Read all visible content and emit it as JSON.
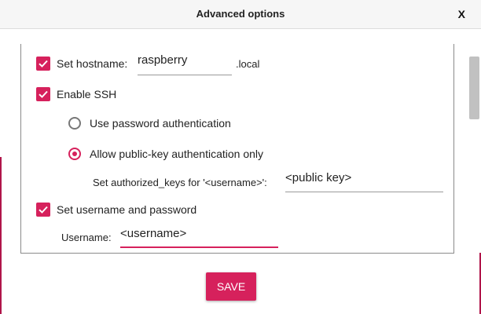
{
  "dialog": {
    "title": "Advanced options",
    "close_label": "X"
  },
  "options": {
    "hostname": {
      "checked": true,
      "label": "Set hostname:",
      "value": "raspberry",
      "suffix": ".local"
    },
    "ssh": {
      "checked": true,
      "label": "Enable SSH",
      "auth_password_label": "Use password authentication",
      "auth_pubkey_label": "Allow public-key authentication only",
      "selected_auth": "pubkey",
      "authorized_keys_label": "Set authorized_keys for '<username>':",
      "authorized_keys_value": "<public key>"
    },
    "user": {
      "checked": true,
      "label": "Set username and password",
      "username_label": "Username:",
      "username_value": "<username>"
    }
  },
  "footer": {
    "save_label": "SAVE"
  },
  "colors": {
    "accent": "#d6215c",
    "dark_accent": "#b0154a"
  },
  "icons": {
    "checkbox": "checkmark-icon",
    "close": "close-icon"
  }
}
